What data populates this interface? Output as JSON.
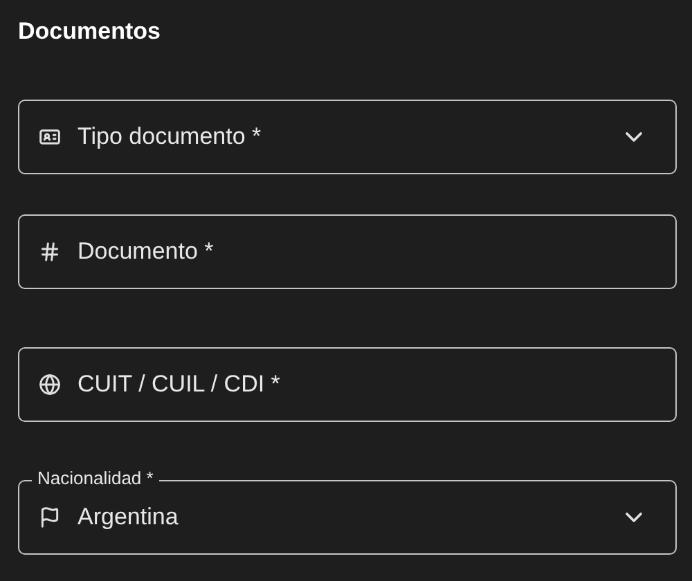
{
  "section": {
    "title": "Documentos"
  },
  "fields": [
    {
      "kind": "select",
      "placeholder": "Tipo documento *"
    },
    {
      "kind": "text",
      "placeholder": "Documento *"
    },
    {
      "kind": "text",
      "placeholder": "CUIT / CUIL / CDI *"
    },
    {
      "kind": "select",
      "label": "Nacionalidad *",
      "value": "Argentina"
    }
  ]
}
